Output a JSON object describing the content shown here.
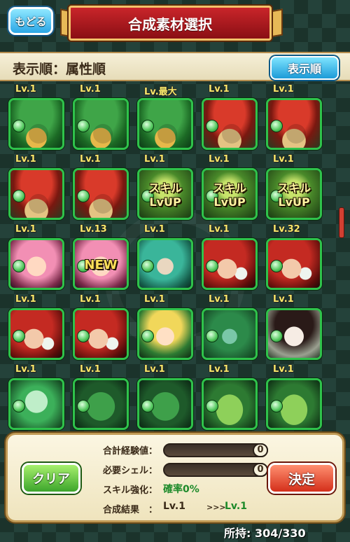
{
  "header": {
    "back_label": "もどる",
    "title": "合成素材選択"
  },
  "sortbar": {
    "label": "表示順：属性順",
    "button_label": "表示順"
  },
  "grid": {
    "cells": [
      {
        "level": "Lv.1",
        "art": "art-snake",
        "tag": ""
      },
      {
        "level": "Lv.1",
        "art": "art-snake",
        "tag": ""
      },
      {
        "level": "Lv.最大",
        "art": "art-snake",
        "tag": ""
      },
      {
        "level": "Lv.1",
        "art": "art-mush",
        "tag": ""
      },
      {
        "level": "Lv.1",
        "art": "art-mush",
        "tag": ""
      },
      {
        "level": "Lv.1",
        "art": "art-mush",
        "tag": ""
      },
      {
        "level": "Lv.1",
        "art": "art-mush",
        "tag": ""
      },
      {
        "level": "Lv.1",
        "art": "art-skill",
        "tag": "スキル\nLvUP"
      },
      {
        "level": "Lv.1",
        "art": "art-skill",
        "tag": "スキル\nLvUP"
      },
      {
        "level": "Lv.1",
        "art": "art-skill",
        "tag": "スキル\nLvUP"
      },
      {
        "level": "Lv.1",
        "art": "art-pinkgirl",
        "tag": ""
      },
      {
        "level": "Lv.13",
        "art": "art-pinkgirl",
        "tag": "NEW"
      },
      {
        "level": "Lv.1",
        "art": "art-tealgirl",
        "tag": ""
      },
      {
        "level": "Lv.1",
        "art": "art-redhair",
        "tag": ""
      },
      {
        "level": "Lv.32",
        "art": "art-redhair",
        "tag": ""
      },
      {
        "level": "Lv.1",
        "art": "art-redhair",
        "tag": ""
      },
      {
        "level": "Lv.1",
        "art": "art-redhair",
        "tag": ""
      },
      {
        "level": "Lv.1",
        "art": "art-blonde",
        "tag": ""
      },
      {
        "level": "Lv.1",
        "art": "art-dragon",
        "tag": ""
      },
      {
        "level": "Lv.1",
        "art": "art-geisha",
        "tag": ""
      },
      {
        "level": "Lv.1",
        "art": "art-mint",
        "tag": ""
      },
      {
        "level": "Lv.1",
        "art": "art-sprout",
        "tag": ""
      },
      {
        "level": "Lv.1",
        "art": "art-sprout",
        "tag": ""
      },
      {
        "level": "Lv.1",
        "art": "art-frog",
        "tag": ""
      },
      {
        "level": "Lv.1",
        "art": "art-frog",
        "tag": ""
      }
    ]
  },
  "panel": {
    "clear_label": "クリア",
    "confirm_label": "決定",
    "total_exp_label": "合計経験値：",
    "total_exp_value": "0",
    "shell_label": "必要シェル：",
    "shell_value": "0",
    "skill_label": "スキル強化：",
    "skill_value": "確率0%",
    "result_label": "合成結果　：",
    "result_before": "Lv.1",
    "result_arrow": ">>>",
    "result_after": "Lv.1"
  },
  "footer": {
    "owned": "所持: 304/330"
  }
}
